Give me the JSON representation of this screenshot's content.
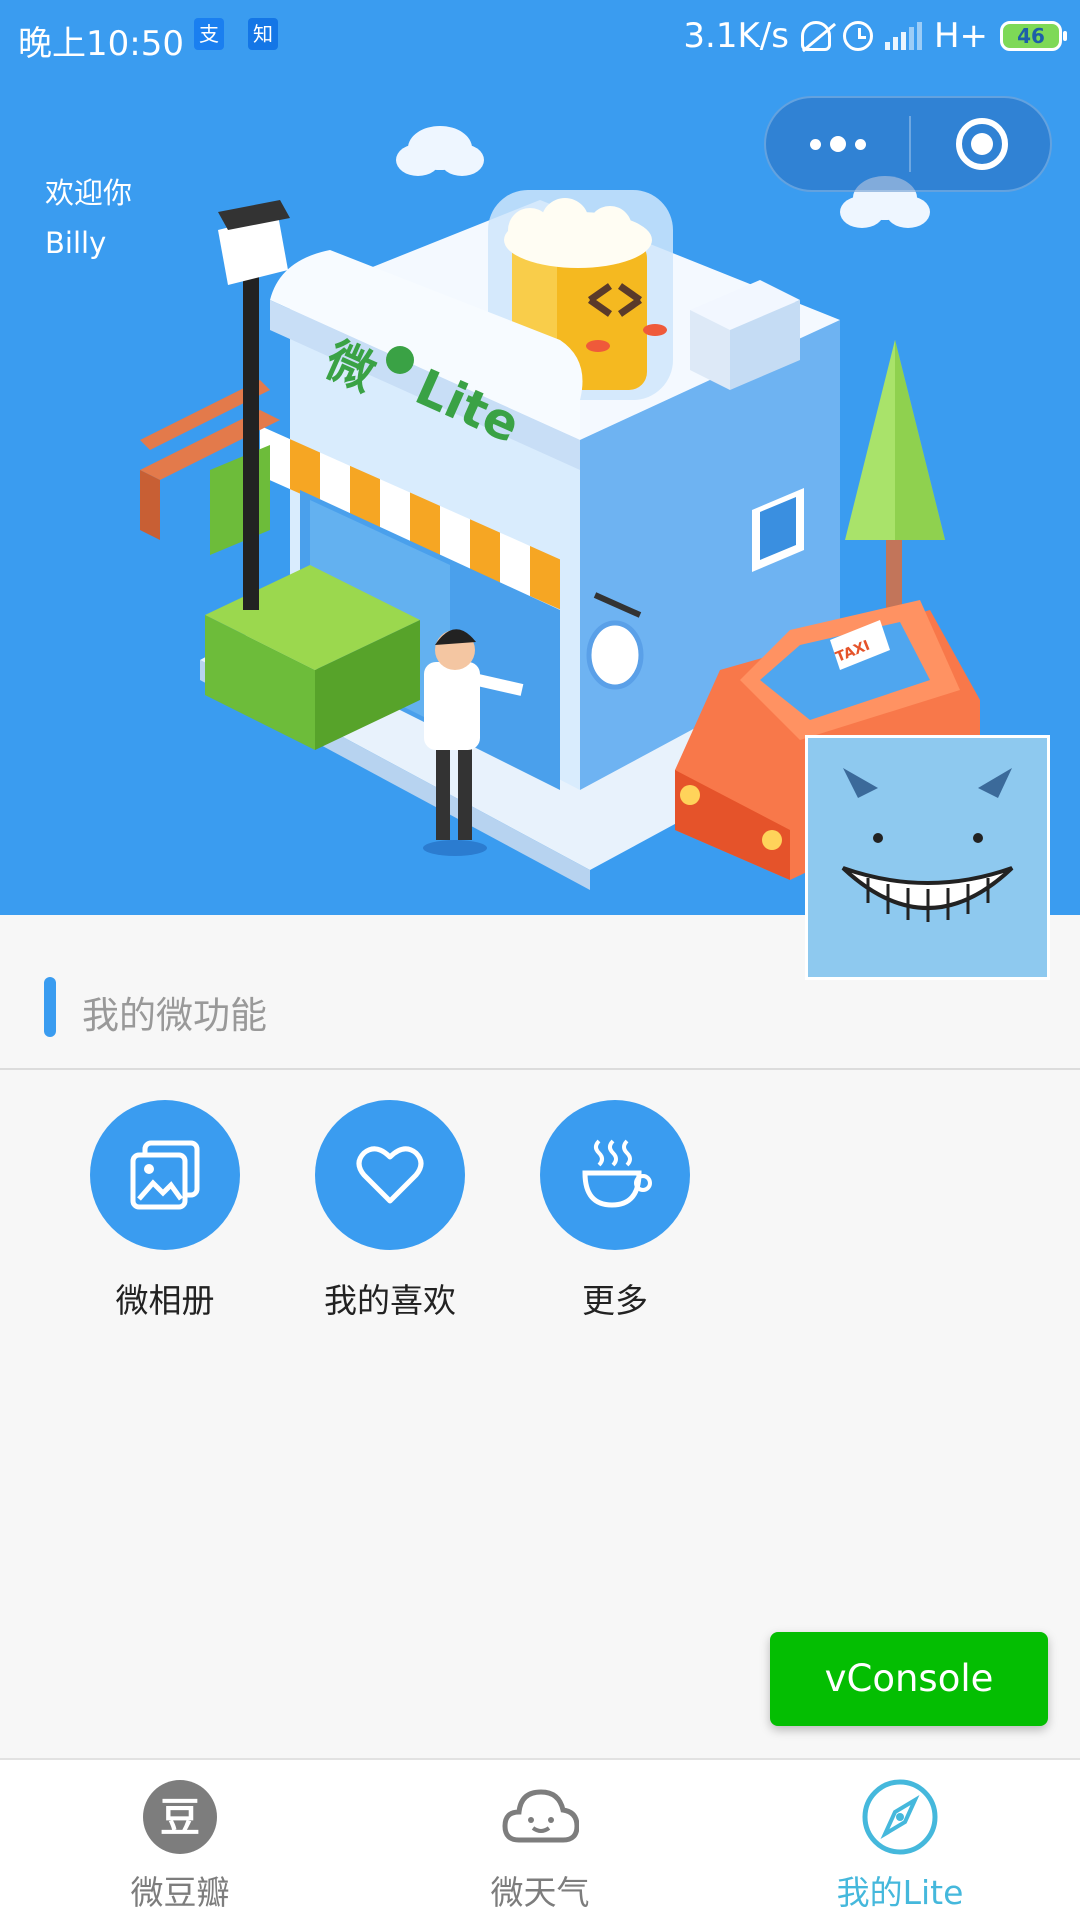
{
  "status_bar": {
    "time": "晚上10:50",
    "app_icons": [
      "支",
      "知"
    ],
    "net_speed": "3.1K/s",
    "network": "H+",
    "battery": "46"
  },
  "header": {
    "welcome": "欢迎你",
    "username": "Billy",
    "logo_text": "Lite",
    "logo_char": "微",
    "taxi_sign": "TAXI"
  },
  "section": {
    "title": "我的微功能"
  },
  "features": [
    {
      "label": "微相册",
      "icon": "photo-album-icon"
    },
    {
      "label": "我的喜欢",
      "icon": "heart-icon"
    },
    {
      "label": "更多",
      "icon": "coffee-cup-icon"
    }
  ],
  "vconsole": {
    "label": "vConsole"
  },
  "tabs": [
    {
      "label": "微豆瓣",
      "icon_char": "豆",
      "icon": "douban-icon",
      "active": false
    },
    {
      "label": "微天气",
      "icon": "cloud-icon",
      "active": false
    },
    {
      "label": "我的Lite",
      "icon": "compass-icon",
      "active": true
    }
  ],
  "colors": {
    "primary": "#3a9cf0",
    "tab_active": "#45b8dc",
    "vconsole": "#04be02"
  }
}
